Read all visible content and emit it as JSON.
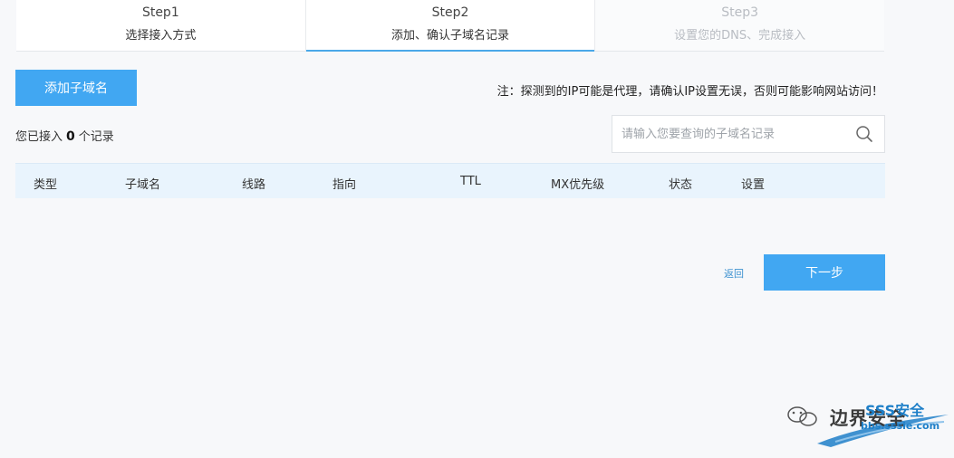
{
  "steps": [
    {
      "title": "Step1",
      "desc": "选择接入方式"
    },
    {
      "title": "Step2",
      "desc": "添加、确认子域名记录"
    },
    {
      "title": "Step3",
      "desc": "设置您的DNS、完成接入"
    }
  ],
  "toolbar": {
    "add_label": "添加子域名",
    "notice": "注：探测到的IP可能是代理，请确认IP设置无误，否则可能影响网站访问！"
  },
  "records": {
    "prefix": "您已接入",
    "count": "0",
    "suffix": "个记录"
  },
  "search": {
    "placeholder": "请输入您要查询的子域名记录"
  },
  "table": {
    "columns": [
      "类型",
      "子域名",
      "线路",
      "指向",
      "TTL",
      "MX优先级",
      "状态",
      "设置"
    ]
  },
  "footer": {
    "back_label": "返回",
    "next_label": "下一步"
  },
  "watermark": {
    "text": "边界安全",
    "brand": "SSS安全",
    "url": "bbs.sssie.com"
  },
  "colors": {
    "accent": "#41a7f2",
    "table_header_bg": "#e9f4fd",
    "link": "#3e92d0"
  },
  "icons": {
    "search": "search-icon",
    "wechat": "wechat-icon"
  }
}
